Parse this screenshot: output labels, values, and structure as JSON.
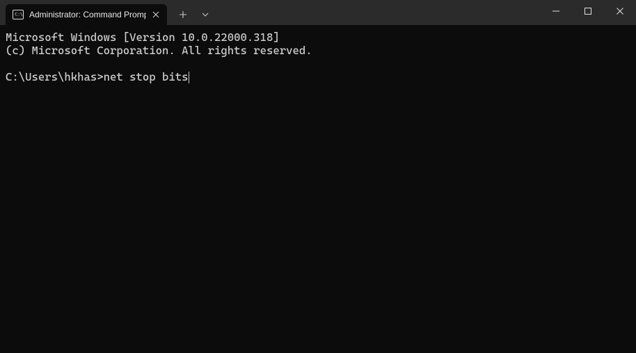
{
  "tab": {
    "title": "Administrator: Command Promp"
  },
  "terminal": {
    "banner_line1": "Microsoft Windows [Version 10.0.22000.318]",
    "banner_line2": "(c) Microsoft Corporation. All rights reserved.",
    "prompt": "C:\\Users\\hkhas>",
    "command": "net stop bits"
  }
}
